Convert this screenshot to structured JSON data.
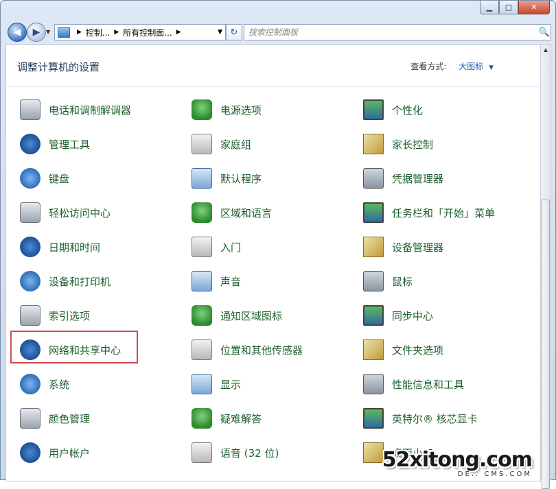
{
  "window": {
    "caption_buttons": {
      "minimize": "▁",
      "maximize": "□",
      "close": "✕"
    }
  },
  "nav": {
    "back": "◀",
    "forward": "▶",
    "history": "▼",
    "breadcrumb": [
      "控制...",
      "所有控制面..."
    ],
    "refresh": "↻",
    "search_placeholder": "搜索控制面板"
  },
  "header": {
    "title": "调整计算机的设置",
    "view_by_label": "查看方式:",
    "view_by_value": "大图标"
  },
  "items": [
    [
      "电话和调制解调器",
      "电源选项",
      "个性化"
    ],
    [
      "管理工具",
      "家庭组",
      "家长控制"
    ],
    [
      "键盘",
      "默认程序",
      "凭据管理器"
    ],
    [
      "轻松访问中心",
      "区域和语言",
      "任务栏和「开始」菜单"
    ],
    [
      "日期和时间",
      "入门",
      "设备管理器"
    ],
    [
      "设备和打印机",
      "声音",
      "鼠标"
    ],
    [
      "索引选项",
      "通知区域图标",
      "同步中心"
    ],
    [
      "网络和共享中心",
      "位置和其他传感器",
      "文件夹选项"
    ],
    [
      "系统",
      "显示",
      "性能信息和工具"
    ],
    [
      "颜色管理",
      "疑难解答",
      "英特尔® 核芯显卡"
    ],
    [
      "用户帐户",
      "语音 (32 位)",
      "桌面小工"
    ]
  ],
  "icons": [
    [
      "phone-modem-icon",
      "power-options-icon",
      "personalization-icon"
    ],
    [
      "admin-tools-icon",
      "homegroup-icon",
      "parental-controls-icon"
    ],
    [
      "keyboard-icon",
      "default-programs-icon",
      "credential-manager-icon"
    ],
    [
      "ease-of-access-icon",
      "region-language-icon",
      "taskbar-start-menu-icon"
    ],
    [
      "date-time-icon",
      "getting-started-icon",
      "device-manager-icon"
    ],
    [
      "devices-printers-icon",
      "sound-icon",
      "mouse-icon"
    ],
    [
      "indexing-options-icon",
      "notification-icons-icon",
      "sync-center-icon"
    ],
    [
      "network-sharing-icon",
      "location-sensors-icon",
      "folder-options-icon"
    ],
    [
      "system-icon",
      "display-icon",
      "performance-info-icon"
    ],
    [
      "color-management-icon",
      "troubleshooting-icon",
      "intel-graphics-icon"
    ],
    [
      "user-accounts-icon",
      "speech-icon",
      "desktop-gadgets-icon"
    ]
  ],
  "colors": {
    "link_green": "#1c5f2c",
    "title_blue": "#1e395b",
    "highlight_red": "#d24b4b"
  },
  "watermark": {
    "main": "52xitong.com",
    "sub": "DE.. CMS.COM"
  }
}
